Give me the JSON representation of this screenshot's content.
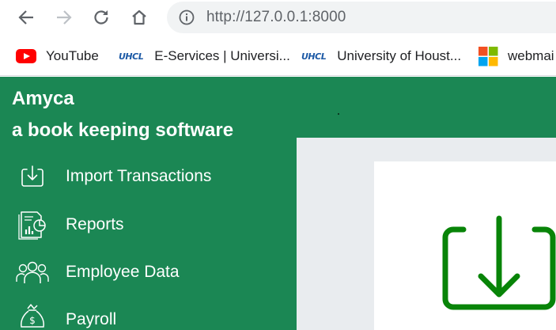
{
  "browser": {
    "url": "http://127.0.0.1:8000",
    "bookmarks": [
      {
        "label": "YouTube",
        "icon": "youtube-icon"
      },
      {
        "label": "E-Services | Universi...",
        "icon": "uhcl-icon",
        "logo_text": "UHCL"
      },
      {
        "label": "University of Houst...",
        "icon": "uhcl-icon",
        "logo_text": "UHCL"
      },
      {
        "label": "webmai",
        "icon": "microsoft-icon"
      }
    ]
  },
  "app": {
    "name": "Amyca",
    "tagline": "a book keeping software",
    "menu": [
      {
        "label": "Import Transactions",
        "icon": "import-icon"
      },
      {
        "label": "Reports",
        "icon": "reports-icon"
      },
      {
        "label": "Employee Data",
        "icon": "employees-icon"
      },
      {
        "label": "Payroll",
        "icon": "payroll-icon"
      }
    ],
    "colors": {
      "sidebar_green": "#1b8754",
      "content_gray": "#e9ecef",
      "import_icon_green": "#088408"
    }
  }
}
